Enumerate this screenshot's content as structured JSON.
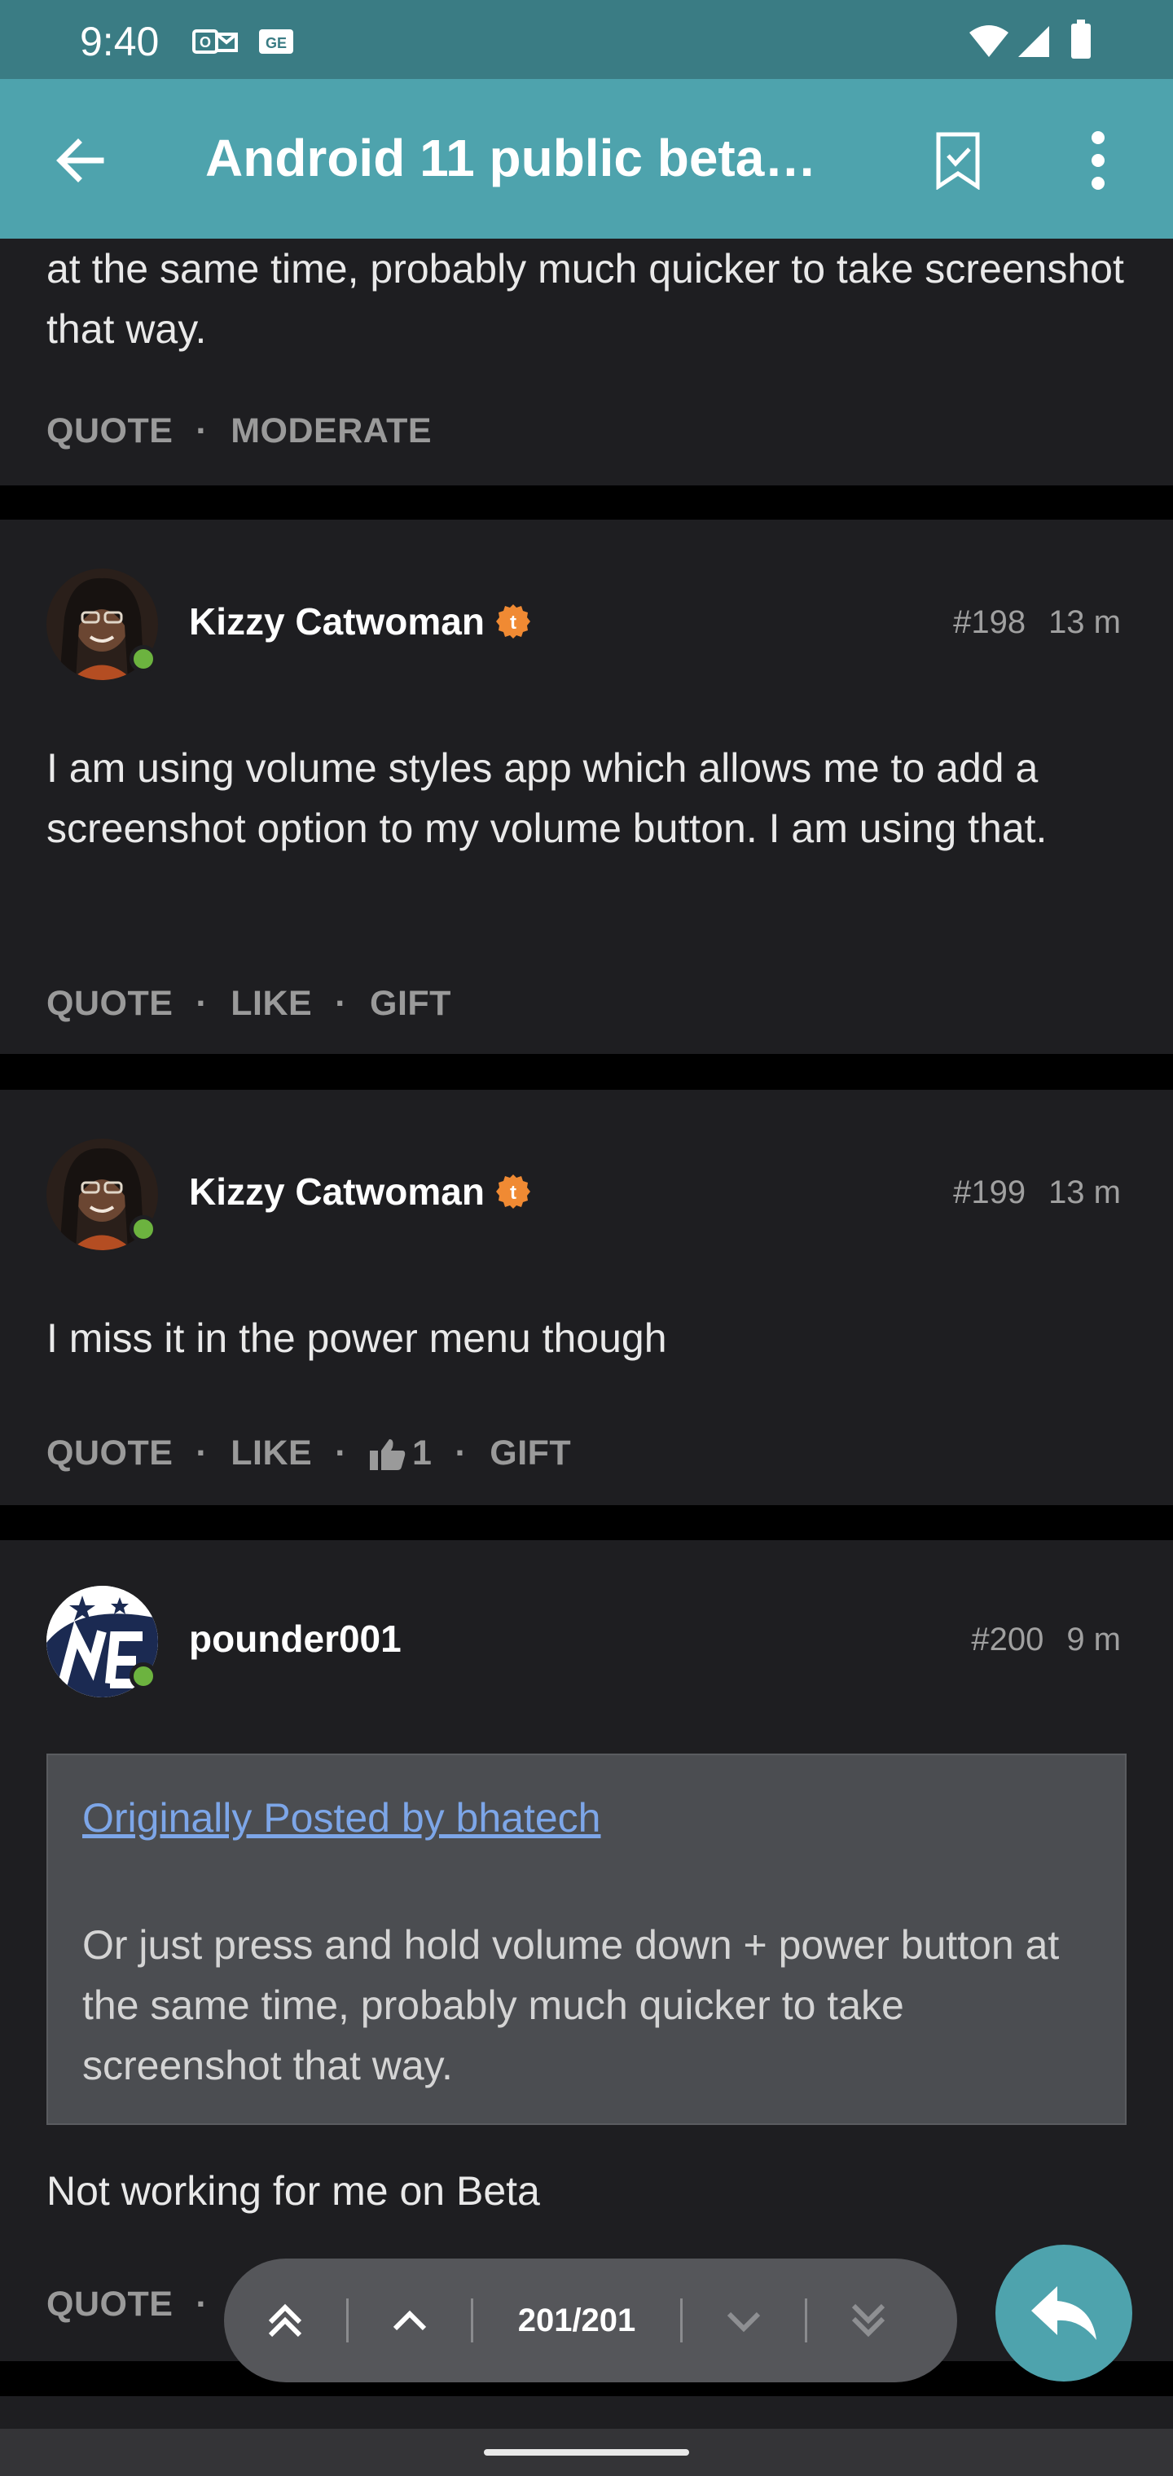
{
  "status_bar": {
    "time": "9:40"
  },
  "app_bar": {
    "title": "Android 11 public beta…"
  },
  "posts": [
    {
      "text": "at the same time, probably much quicker to take screenshot that way.",
      "actions": [
        "QUOTE",
        "MODERATE"
      ]
    },
    {
      "author": "Kizzy Catwoman",
      "number": "#198",
      "time": "13 m",
      "text": "I am using volume styles app which allows me to add a screenshot option to my volume button. I am using that.",
      "actions": [
        "QUOTE",
        "LIKE",
        "GIFT"
      ]
    },
    {
      "author": "Kizzy Catwoman",
      "number": "#199",
      "time": "13 m",
      "text": "I miss it in the power menu though",
      "actions": [
        "QUOTE",
        "LIKE",
        "GIFT"
      ],
      "like_count": "1"
    },
    {
      "author": "pounder001",
      "number": "#200",
      "time": "9 m",
      "quote_link": "Originally Posted by bhatech",
      "quote_text": "Or just press and hold volume down + power button at the same time, probably much quicker to take screenshot that way.",
      "text": "Not working for me on Beta",
      "actions": [
        "QUOTE"
      ]
    }
  ],
  "navigator": {
    "page": "201/201"
  },
  "colors": {
    "accent": "#4ea3ad",
    "status_bar": "#3a7c84",
    "card": "#1e1e21",
    "online": "#6cb33f",
    "link": "#7da6e8"
  }
}
